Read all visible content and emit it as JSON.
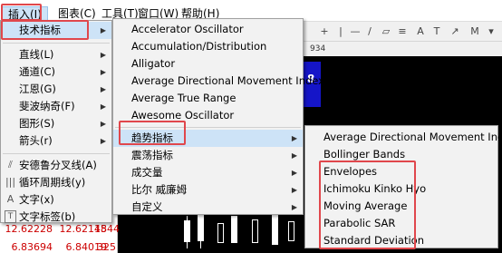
{
  "menubar": {
    "items": [
      "插入(I)",
      "图表(C)",
      "工具(T)",
      "窗口(W)",
      "帮助(H)"
    ]
  },
  "chart": {
    "header_value": "934",
    "box_value": "8"
  },
  "data_grid": {
    "rows": [
      [
        "12.62228",
        "12.62145",
        "1844"
      ],
      [
        "6.83694",
        "6.84019",
        "325"
      ]
    ]
  },
  "insert_menu": {
    "items": [
      {
        "label": "技术指标",
        "has_submenu": true,
        "icon": "none"
      },
      {
        "label": "直线(L)",
        "has_submenu": true,
        "icon": "none"
      },
      {
        "label": "通道(C)",
        "has_submenu": true,
        "icon": "none"
      },
      {
        "label": "江恩(G)",
        "has_submenu": true,
        "icon": "none"
      },
      {
        "label": "斐波纳奇(F)",
        "has_submenu": true,
        "icon": "none"
      },
      {
        "label": "图形(S)",
        "has_submenu": true,
        "icon": "none"
      },
      {
        "label": "箭头(r)",
        "has_submenu": true,
        "icon": "none"
      },
      {
        "label": "安德鲁分叉线(A)",
        "has_submenu": false,
        "icon": "pitchfork-icon"
      },
      {
        "label": "循环周期线(y)",
        "has_submenu": false,
        "icon": "cycle-lines-icon"
      },
      {
        "label": "文字(x)",
        "has_submenu": false,
        "icon": "text-icon"
      },
      {
        "label": "文字标签(b)",
        "has_submenu": false,
        "icon": "text-label-icon"
      }
    ]
  },
  "indicator_menu": {
    "items": [
      {
        "label": "Accelerator Oscillator",
        "has_submenu": false
      },
      {
        "label": "Accumulation/Distribution",
        "has_submenu": false
      },
      {
        "label": "Alligator",
        "has_submenu": false
      },
      {
        "label": "Average Directional Movement Index",
        "has_submenu": false
      },
      {
        "label": "Average True Range",
        "has_submenu": false
      },
      {
        "label": "Awesome Oscillator",
        "has_submenu": false
      },
      {
        "label": "趋势指标",
        "has_submenu": true
      },
      {
        "label": "震荡指标",
        "has_submenu": true
      },
      {
        "label": "成交量",
        "has_submenu": true
      },
      {
        "label": "比尔 威廉姆",
        "has_submenu": true
      },
      {
        "label": "自定义",
        "has_submenu": true
      }
    ]
  },
  "trend_menu": {
    "items": [
      "Average Directional Movement Index",
      "Bollinger Bands",
      "Envelopes",
      "Ichimoku Kinko Hyo",
      "Moving Average",
      "Parabolic SAR",
      "Standard Deviation"
    ]
  },
  "colors": {
    "highlight": "#cde3f7",
    "annotation_red": "#e0474c",
    "chart_bg": "#000000",
    "chart_box": "#1515c8"
  }
}
